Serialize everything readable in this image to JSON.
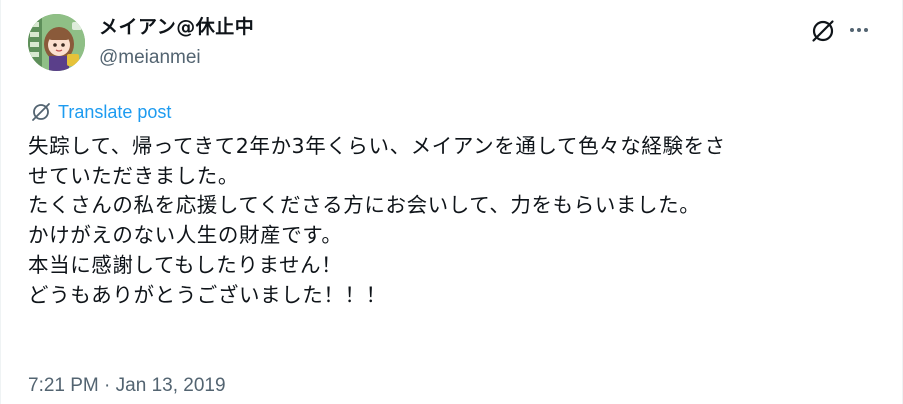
{
  "post": {
    "author": {
      "display_name": "メイアン@休止中",
      "handle": "@meianmei",
      "avatar_icon": "avatar-image"
    },
    "actions": {
      "grok_icon": "grok-slash-icon",
      "more_icon": "more-horizontal-icon"
    },
    "translate": {
      "icon": "translate-icon",
      "label": "Translate post"
    },
    "body_lines": [
      "失踪して、帰ってきて2年か3年くらい、メイアンを通して色々な経験をさ",
      "せていただきました。",
      "たくさんの私を応援してくださる方にお会いして、力をもらいました。",
      "かけがえのない人生の財産です。",
      "本当に感謝してもしたりません！",
      "どうもありがとうございました！！！"
    ],
    "timestamp": {
      "time": "7:21 PM",
      "separator": " · ",
      "date": "Jan 13, 2019"
    }
  },
  "colors": {
    "text": "#0f1419",
    "secondary": "#536471",
    "accent": "#1d9bf0",
    "border": "#eff3f4"
  }
}
